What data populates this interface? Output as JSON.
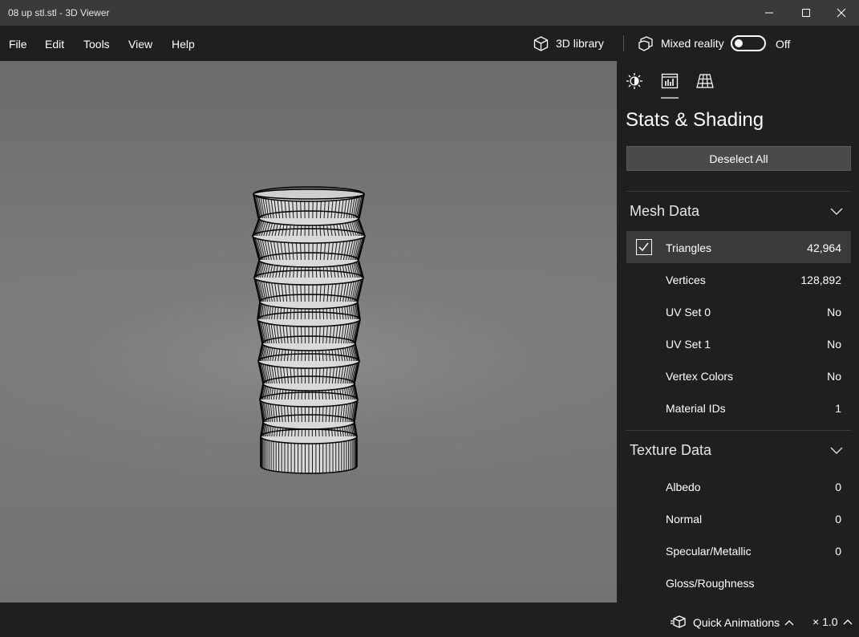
{
  "window": {
    "title": "08 up stl.stl - 3D Viewer"
  },
  "menu": {
    "file": "File",
    "edit": "Edit",
    "tools": "Tools",
    "view": "View",
    "help": "Help"
  },
  "toolbar": {
    "library_label": "3D library",
    "mixed_reality_label": "Mixed reality",
    "toggle_state": "Off"
  },
  "panel": {
    "tabs": [
      "lighting",
      "stats",
      "grid"
    ],
    "active_tab": "stats",
    "heading": "Stats & Shading",
    "deselect_label": "Deselect All",
    "mesh": {
      "title": "Mesh Data",
      "rows": [
        {
          "name": "Triangles",
          "value": "42,964",
          "checked": true
        },
        {
          "name": "Vertices",
          "value": "128,892"
        },
        {
          "name": "UV Set 0",
          "value": "No"
        },
        {
          "name": "UV Set 1",
          "value": "No"
        },
        {
          "name": "Vertex Colors",
          "value": "No"
        },
        {
          "name": "Material IDs",
          "value": "1"
        }
      ]
    },
    "texture": {
      "title": "Texture Data",
      "rows": [
        {
          "name": "Albedo",
          "value": "0"
        },
        {
          "name": "Normal",
          "value": "0"
        },
        {
          "name": "Specular/Metallic",
          "value": "0"
        },
        {
          "name": "Gloss/Roughness",
          "value": ""
        }
      ]
    }
  },
  "status": {
    "quick_animations": "Quick Animations",
    "speed": "× 1.0"
  }
}
